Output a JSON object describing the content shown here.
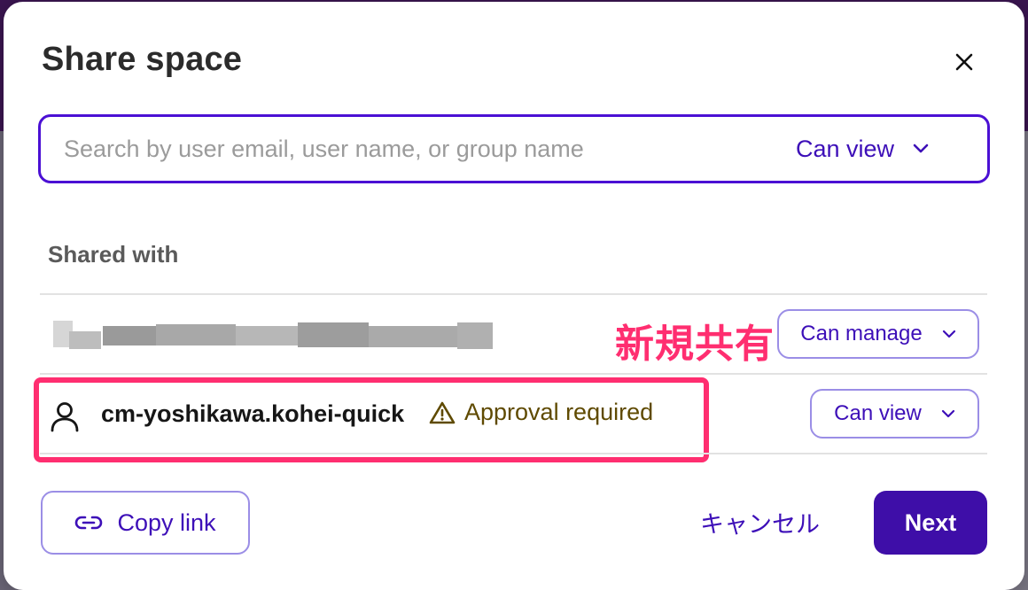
{
  "dialog": {
    "title": "Share space",
    "close_label": "Close"
  },
  "search": {
    "placeholder": "Search by user email, user name, or group name",
    "permission": "Can view"
  },
  "shared_with": {
    "heading": "Shared with",
    "entries": [
      {
        "name": "",
        "blurred": true,
        "permission": "Can manage"
      },
      {
        "name": "cm-yoshikawa.kohei-quick",
        "status": "Approval required",
        "permission": "Can view"
      }
    ]
  },
  "annotation": {
    "label": "新規共有",
    "color": "#ff2e70"
  },
  "footer": {
    "copy_link": "Copy link",
    "cancel": "キャンセル",
    "next": "Next"
  },
  "colors": {
    "accent": "#3d0fb8",
    "primary_button": "#3e0ea8",
    "focus_border": "#4b10d4",
    "warning_text": "#5f4a00"
  },
  "icons": {
    "close": "close-icon",
    "dropdown": "chevron-down-icon",
    "user": "user-icon",
    "warning": "warning-icon",
    "link": "link-icon"
  }
}
